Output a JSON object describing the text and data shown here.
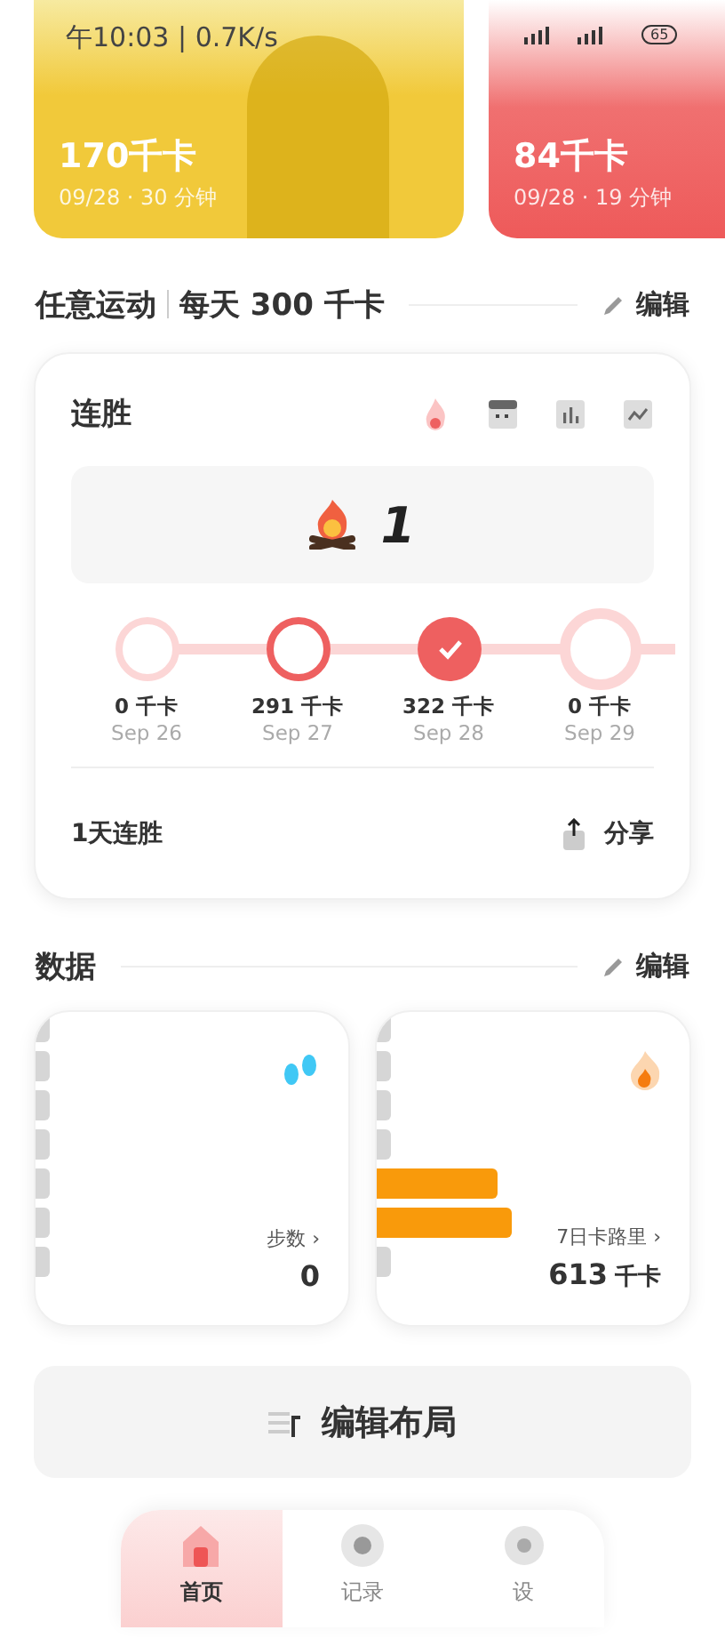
{
  "status_bar": {
    "time": "午10:03 | 0.7K/s",
    "battery": "65"
  },
  "workout_cards": [
    {
      "kind": "yellow",
      "calories": "170千卡",
      "meta": "09/28 · 30 分钟"
    },
    {
      "kind": "red",
      "calories": "84千卡",
      "meta": "09/28 · 19 分钟"
    }
  ],
  "goal": {
    "title": "任意运动",
    "target": "每天 300 千卡",
    "edit": "编辑"
  },
  "streak": {
    "title": "连胜",
    "views": [
      {
        "kind": "flame",
        "selected": true
      },
      {
        "kind": "calendar",
        "selected": false
      },
      {
        "kind": "bars",
        "selected": false
      },
      {
        "kind": "trend",
        "selected": false
      }
    ],
    "count": "1",
    "days": [
      {
        "checked": false,
        "active": false,
        "selected": false,
        "value": "0 千卡",
        "date": "Sep 26"
      },
      {
        "checked": false,
        "active": true,
        "selected": false,
        "value": "291 千卡",
        "date": "Sep 27"
      },
      {
        "checked": true,
        "active": false,
        "selected": false,
        "value": "322 千卡",
        "date": "Sep 28"
      },
      {
        "checked": false,
        "active": false,
        "selected": true,
        "value": "0 千卡",
        "date": "Sep 29"
      }
    ],
    "summary": "1天连胜",
    "share": "分享"
  },
  "data": {
    "title": "数据",
    "edit": "编辑",
    "cards": [
      {
        "kind": "steps",
        "label": "步数",
        "chevron": "›",
        "value": "0"
      },
      {
        "kind": "calories",
        "label": "7日卡路里",
        "chevron": "›",
        "value": "613",
        "unit": "千卡"
      }
    ]
  },
  "layout_button": "编辑布局",
  "nav": [
    {
      "kind": "home",
      "label": "首页",
      "selected": true
    },
    {
      "kind": "record",
      "label": "记录",
      "selected": false
    },
    {
      "kind": "settings",
      "label": "设",
      "selected": false
    }
  ]
}
